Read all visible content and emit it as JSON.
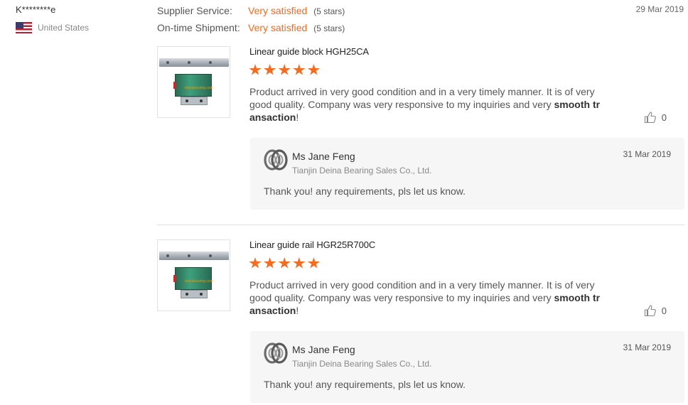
{
  "reviewer": {
    "name": "K********e",
    "country": "United States",
    "flag_icon": "us-flag-icon"
  },
  "ratings": [
    {
      "label": "Supplier Service:",
      "value": "Very satisfied",
      "stars_text": "(5 stars)"
    },
    {
      "label": "On-time Shipment:",
      "value": "Very satisfied",
      "stars_text": "(5 stars)"
    }
  ],
  "review_date": "29 Mar 2019",
  "accent_color": "#f26c21",
  "reviews": [
    {
      "product_title": "Linear guide block HGH25CA",
      "image_watermark": "deinabearing.com",
      "rating_value": 5,
      "rating_max": 5,
      "text_line1": "Product arrived in very good condition and in a very timely manner.  It is of very",
      "text_line2_pre": "good quality.  Company was very responsive to my inquiries and very ",
      "text_bold_1": "smooth tr",
      "text_bold_2": "ansaction",
      "text_tail": "!",
      "like_count": "0",
      "reply": {
        "name": "Ms Jane Feng",
        "company": "Tianjin Deina Bearing Sales Co., Ltd.",
        "date": "31 Mar 2019",
        "text": "Thank you! any  requirements, pls let us know."
      }
    },
    {
      "product_title": "Linear guide rail HGR25R700C",
      "image_watermark": "deinabearing.com",
      "rating_value": 5,
      "rating_max": 5,
      "text_line1": "Product arrived in very good condition and in a very timely manner.  It is of very",
      "text_line2_pre": "good quality.  Company was very responsive to my inquiries and very ",
      "text_bold_1": "smooth tr",
      "text_bold_2": "ansaction",
      "text_tail": "!",
      "like_count": "0",
      "reply": {
        "name": "Ms Jane Feng",
        "company": "Tianjin Deina Bearing Sales Co., Ltd.",
        "date": "31 Mar 2019",
        "text": "Thank you! any  requirements, pls let us know."
      }
    }
  ]
}
